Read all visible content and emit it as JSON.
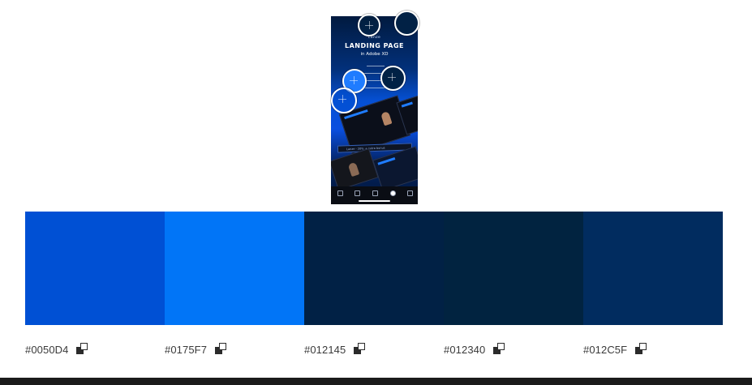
{
  "preview": {
    "logo_text": "Lanze",
    "title": "LANDING PAGE",
    "subtitle": "in Adobe XD",
    "banner_text": "Lanze - 20% + extra bonus"
  },
  "palette": {
    "colors": [
      {
        "hex": "#0050D4",
        "label": "#0050D4"
      },
      {
        "hex": "#0175F7",
        "label": "#0175F7"
      },
      {
        "hex": "#012145",
        "label": "#012145"
      },
      {
        "hex": "#012340",
        "label": "#012340"
      },
      {
        "hex": "#012C5F",
        "label": "#012C5F"
      }
    ]
  },
  "icons": {
    "copy": "copy-icon",
    "hotspot": "hotspot-marker-icon"
  }
}
